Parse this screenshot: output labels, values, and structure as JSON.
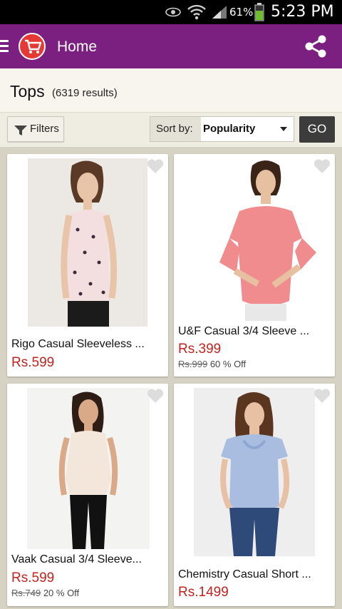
{
  "status_bar": {
    "battery": "61%",
    "time": "5:23 PM"
  },
  "header": {
    "title": "Home"
  },
  "listing": {
    "title": "Tops",
    "count": "(6319 results)"
  },
  "toolbar": {
    "filters_label": "Filters",
    "sort_label": "Sort by:",
    "sort_value": "Popularity",
    "go_label": "GO"
  },
  "products": [
    {
      "name": "Rigo Casual Sleeveless ...",
      "price": "Rs.599",
      "old_price": "",
      "discount": ""
    },
    {
      "name": "U&F Casual 3/4 Sleeve ...",
      "price": "Rs.399",
      "old_price": "Rs.999",
      "discount": "60 % Off"
    },
    {
      "name": "Vaak Casual 3/4 Sleeve...",
      "price": "Rs.599",
      "old_price": "Rs.749",
      "discount": "20 % Off"
    },
    {
      "name": "Chemistry Casual Short ...",
      "price": "Rs.1499",
      "old_price": "",
      "discount": ""
    }
  ],
  "colors": {
    "action_bar": "#7b1f80",
    "price": "#c2231f",
    "background": "#d6d3c4"
  }
}
